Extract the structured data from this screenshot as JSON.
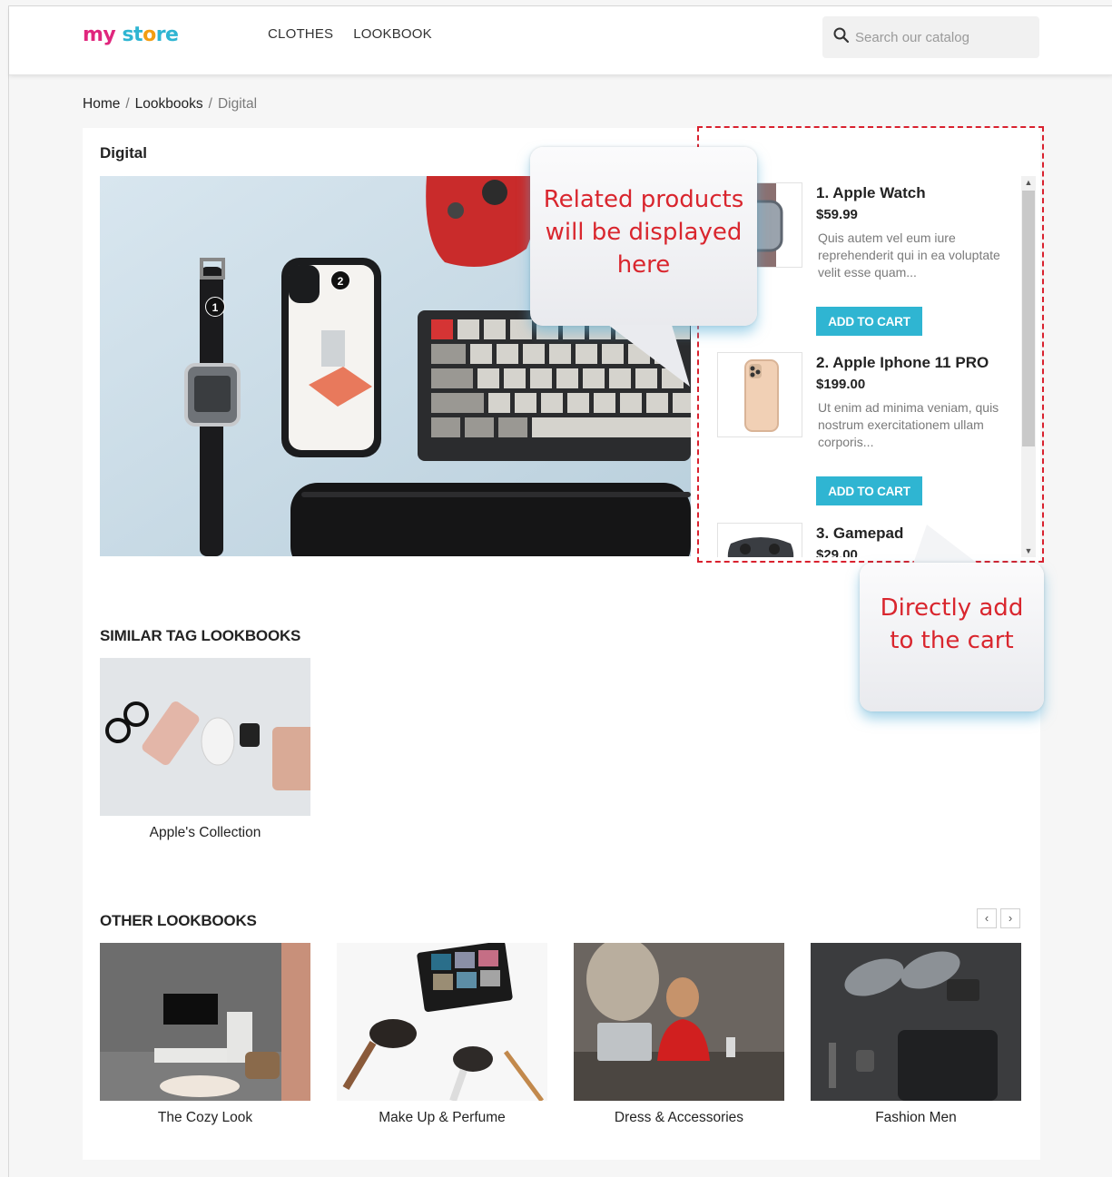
{
  "header": {
    "logo": {
      "part1": "my",
      "part2": "st",
      "part3": "o",
      "part4": "re"
    },
    "nav": [
      "CLOTHES",
      "LOOKBOOK"
    ],
    "search_placeholder": "Search our catalog"
  },
  "breadcrumb": {
    "items": [
      "Home",
      "Lookbooks",
      "Digital"
    ]
  },
  "lookbook": {
    "title": "Digital",
    "pins": [
      "1",
      "2"
    ]
  },
  "related_products": [
    {
      "name": "1. Apple Watch",
      "price": "$59.99",
      "desc": "Quis autem vel eum iure reprehenderit qui in ea voluptate velit esse quam...",
      "button": "ADD TO CART"
    },
    {
      "name": "2. Apple Iphone 11 PRO",
      "price": "$199.00",
      "desc": "Ut enim ad minima veniam, quis nostrum exercitationem ullam corporis...",
      "button": "ADD TO CART"
    },
    {
      "name": "3. Gamepad",
      "price": "$29.00"
    }
  ],
  "callouts": {
    "related_line1": "Related products",
    "related_line2": "will be displayed",
    "related_line3": "here",
    "cart_line1": "Directly add",
    "cart_line2": "to the cart"
  },
  "similar": {
    "title": "SIMILAR TAG LOOKBOOKS",
    "items": [
      {
        "caption": "Apple's Collection"
      }
    ]
  },
  "other": {
    "title": "OTHER LOOKBOOKS",
    "prev": "‹",
    "next": "›",
    "items": [
      {
        "caption": "The Cozy Look"
      },
      {
        "caption": "Make Up & Perfume"
      },
      {
        "caption": "Dress & Accessories"
      },
      {
        "caption": "Fashion Men"
      }
    ]
  },
  "colors": {
    "accent": "#2fb5d2",
    "callout_text": "#d9262e",
    "dash": "#d9212e"
  }
}
